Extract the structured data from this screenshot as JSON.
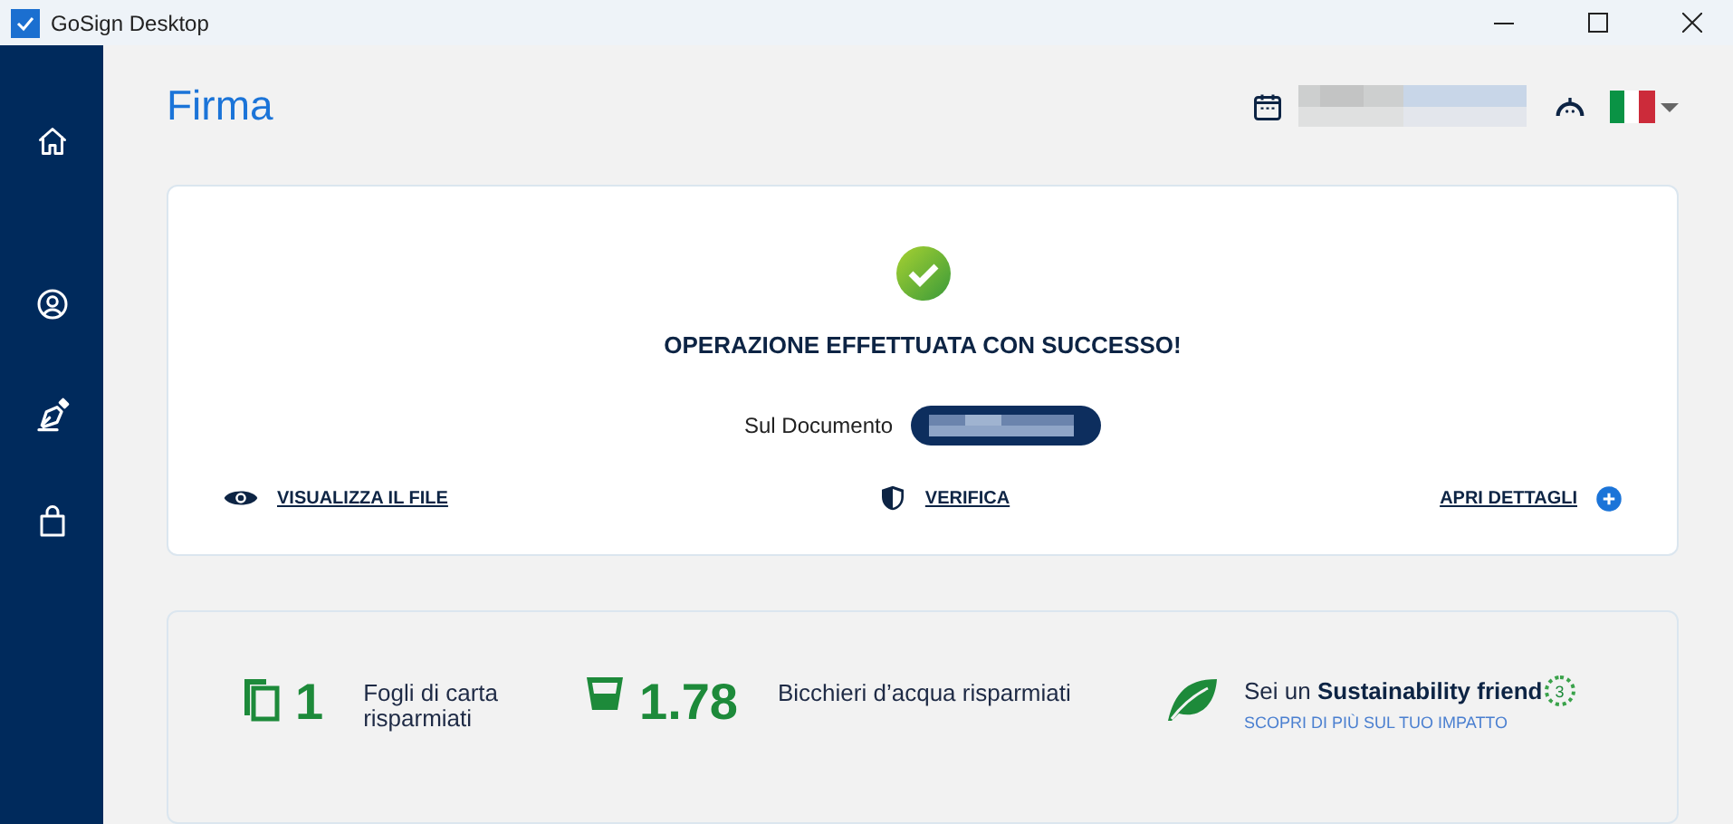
{
  "window": {
    "title": "GoSign Desktop"
  },
  "page": {
    "title": "Firma"
  },
  "result": {
    "message": "OPERAZIONE EFFETTUATA CON SUCCESSO!",
    "document_label": "Sul Documento",
    "actions": [
      {
        "kind": "view",
        "label": "VISUALIZZA IL FILE"
      },
      {
        "kind": "verify",
        "label": "VERIFICA"
      },
      {
        "kind": "details",
        "label": "APRI DETTAGLI"
      }
    ]
  },
  "stats": [
    {
      "kind": "paper",
      "value": "1",
      "label": "Fogli di carta risparmiati"
    },
    {
      "kind": "water",
      "value": "1.78",
      "label": "Bicchieri d’acqua risparmiati"
    }
  ],
  "sustainability": {
    "text": "Sei un **Sustainability friend**",
    "level_badge": "3",
    "link": "SCOPRI DI PIÙ SUL TUO IMPATTO"
  }
}
